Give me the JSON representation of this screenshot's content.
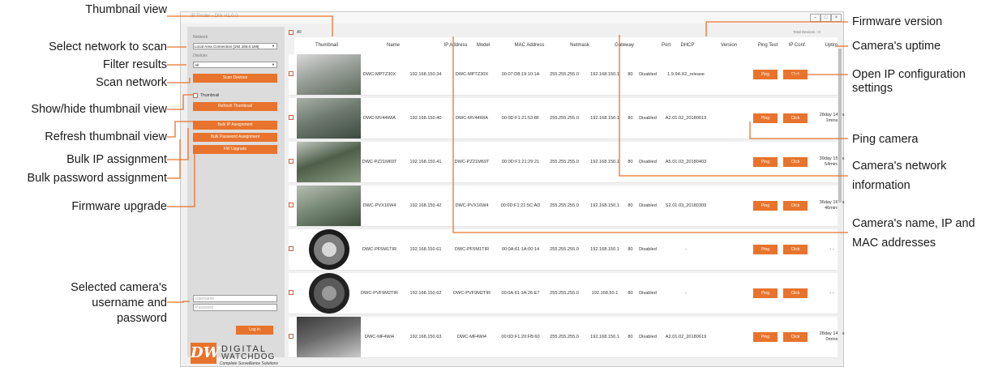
{
  "app": {
    "title": "IP Finder - DW V1.0.0",
    "left_panel": {
      "network_label": "Network",
      "network_value": "Local Area Connection [192.168.0.186]",
      "devices_label": "Devices",
      "devices_value": "All",
      "scan_button": "Scan Devices",
      "thumbnail_label": "Thumbnail",
      "refresh_button": "Refresh Thumbnail",
      "bulk_ip_button": "Bulk IP Assignment",
      "bulk_password_button": "Bulk Password Assignment",
      "fw_upgrade_button": "FW Upgrade",
      "username_placeholder": "Username",
      "password_placeholder": "Password",
      "login_button": "Log in",
      "logo": {
        "mark": "DW",
        "brand_line1": "DIGITAL",
        "brand_line2": "WATCHDOG",
        "tagline": "Complete Surveillance Solutions"
      }
    },
    "all_label": "All",
    "total_devices": "Total Devices : 0",
    "columns": [
      "Thumbnail",
      "Name",
      "IP Address",
      "Model",
      "MAC Address",
      "Netmask",
      "Gateway",
      "Port",
      "DHCP",
      "Version",
      "Ping Test",
      "IP Conf.",
      "Uptime"
    ],
    "ping_label": "Ping",
    "click_label": "Click",
    "rows": [
      {
        "name": "DWC-MPTZ30X",
        "ip": "192.168.150.34",
        "model": "DWC-MPTZ30X",
        "mac": "00:07:D8:19:10:1A",
        "netmask": "255.255.255.0",
        "gateway": "192.168.150.1",
        "port": "80",
        "dhcp": "Disabled",
        "version": "1.9.94-X2_release",
        "uptime_1": "",
        "uptime_2": ""
      },
      {
        "name": "DWC-MV44WiA",
        "ip": "192.168.150.40",
        "model": "DWC-MV44WiA",
        "mac": "00:0D:F1:21:53:8F",
        "netmask": "255.255.255.0",
        "gateway": "192.168.150.1",
        "port": "80",
        "dhcp": "Disabled",
        "version": "A2.01.02_20180619",
        "uptime_1": "28day 14hrs",
        "uptime_2": "1mins"
      },
      {
        "name": "DWC-PZ21M69T",
        "ip": "192.168.150.41",
        "model": "DWC-PZ21M69T",
        "mac": "00:0D:F1:21:29:21",
        "netmask": "255.255.255.0",
        "gateway": "192.168.150.1",
        "port": "80",
        "dhcp": "Disabled",
        "version": "A5.01.03_20180403",
        "uptime_1": "39day 15hrs",
        "uptime_2": "54mins"
      },
      {
        "name": "DWC-PVX16W4",
        "ip": "192.168.150.42",
        "model": "DWC-PVX16W4",
        "mac": "00:0D:F1:21:5C:AD",
        "netmask": "255.255.255.0",
        "gateway": "192.168.150.1",
        "port": "80",
        "dhcp": "Disabled",
        "version": "S2.01.03_20180309",
        "uptime_1": "36day 16hrs",
        "uptime_2": "46mins"
      },
      {
        "name": "DWC-PF5M1TIR",
        "ip": "192.168.150.61",
        "model": "DWC-PF5M1TIR",
        "mac": "00:0A:61:1A:00:14",
        "netmask": "255.255.255.0",
        "gateway": "192.168.150.1",
        "port": "80",
        "dhcp": "Disabled",
        "version": "-",
        "uptime_1": "- -",
        "uptime_2": ""
      },
      {
        "name": "DWC-PVF9M2TIR",
        "ip": "192.168.150.62",
        "model": "DWC-PVF9M2TIR",
        "mac": "00:0A:61:1A:26:E7",
        "netmask": "255.255.255.0",
        "gateway": "192.168.50.1",
        "port": "80",
        "dhcp": "Disabled",
        "version": "-",
        "uptime_1": "- -",
        "uptime_2": ""
      },
      {
        "name": "DWC-MF4Wi4",
        "ip": "192.168.150.63",
        "model": "DWC-MF4Wi4",
        "mac": "00:0D:F1:20:FB:60",
        "netmask": "255.255.255.0",
        "gateway": "192.168.150.1",
        "port": "80",
        "dhcp": "Disabled",
        "version": "A2.01.02_20180619",
        "uptime_1": "28day 14hrs",
        "uptime_2": "0mins"
      }
    ]
  },
  "annotations": {
    "thumbnail_view": "Thumbnail view",
    "select_network": "Select network to scan",
    "filter_results": "Filter results",
    "scan_network": "Scan network",
    "show_hide_thumbnail": "Show/hide thumbnail view",
    "refresh_thumbnail": "Refresh thumbnail view",
    "bulk_ip": "Bulk IP assignment",
    "bulk_password": "Bulk password assignment",
    "firmware_upgrade": "Firmware upgrade",
    "credentials_1": "Selected camera's",
    "credentials_2": "username and",
    "credentials_3": "password",
    "firmware_version": "Firmware version",
    "uptime": "Camera's uptime",
    "ip_config_1": "Open IP configuration",
    "ip_config_2": "settings",
    "ping_camera": "Ping camera",
    "network_info_1": "Camera's network",
    "network_info_2": "information",
    "name_ip_mac_1": "Camera's name, IP and",
    "name_ip_mac_2": "MAC addresses"
  },
  "colors": {
    "accent": "#e8732c",
    "line": "#e8732c",
    "panel": "#dcdcdc"
  }
}
